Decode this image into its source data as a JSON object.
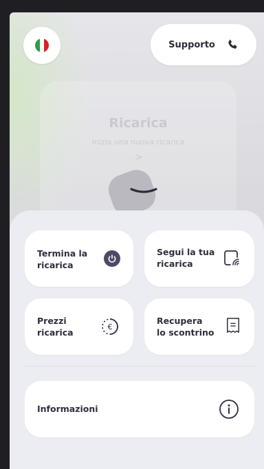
{
  "header": {
    "support_label": "Supporto"
  },
  "background_card": {
    "title": "Ricarica",
    "subtitle": "Inizia una nuova ricarica",
    "chevron": ">"
  },
  "sheet": {
    "tiles": [
      {
        "label_line1": "Termina la",
        "label_line2": "ricarica",
        "icon": "power-icon"
      },
      {
        "label_line1": "Segui la tua",
        "label_line2": "ricarica",
        "icon": "track-charging-icon"
      },
      {
        "label_line1": "Prezzi",
        "label_line2": "ricarica",
        "icon": "euro-icon"
      },
      {
        "label_line1": "Recupera",
        "label_line2": "lo scontrino",
        "icon": "receipt-icon"
      }
    ],
    "info_label": "Informazioni"
  },
  "colors": {
    "accent": "#4c4a66",
    "text": "#2e2e3e",
    "sheet_bg": "#ececf3",
    "flag_green": "#2e9b4a",
    "flag_white": "#ffffff",
    "flag_red": "#d3232b"
  }
}
